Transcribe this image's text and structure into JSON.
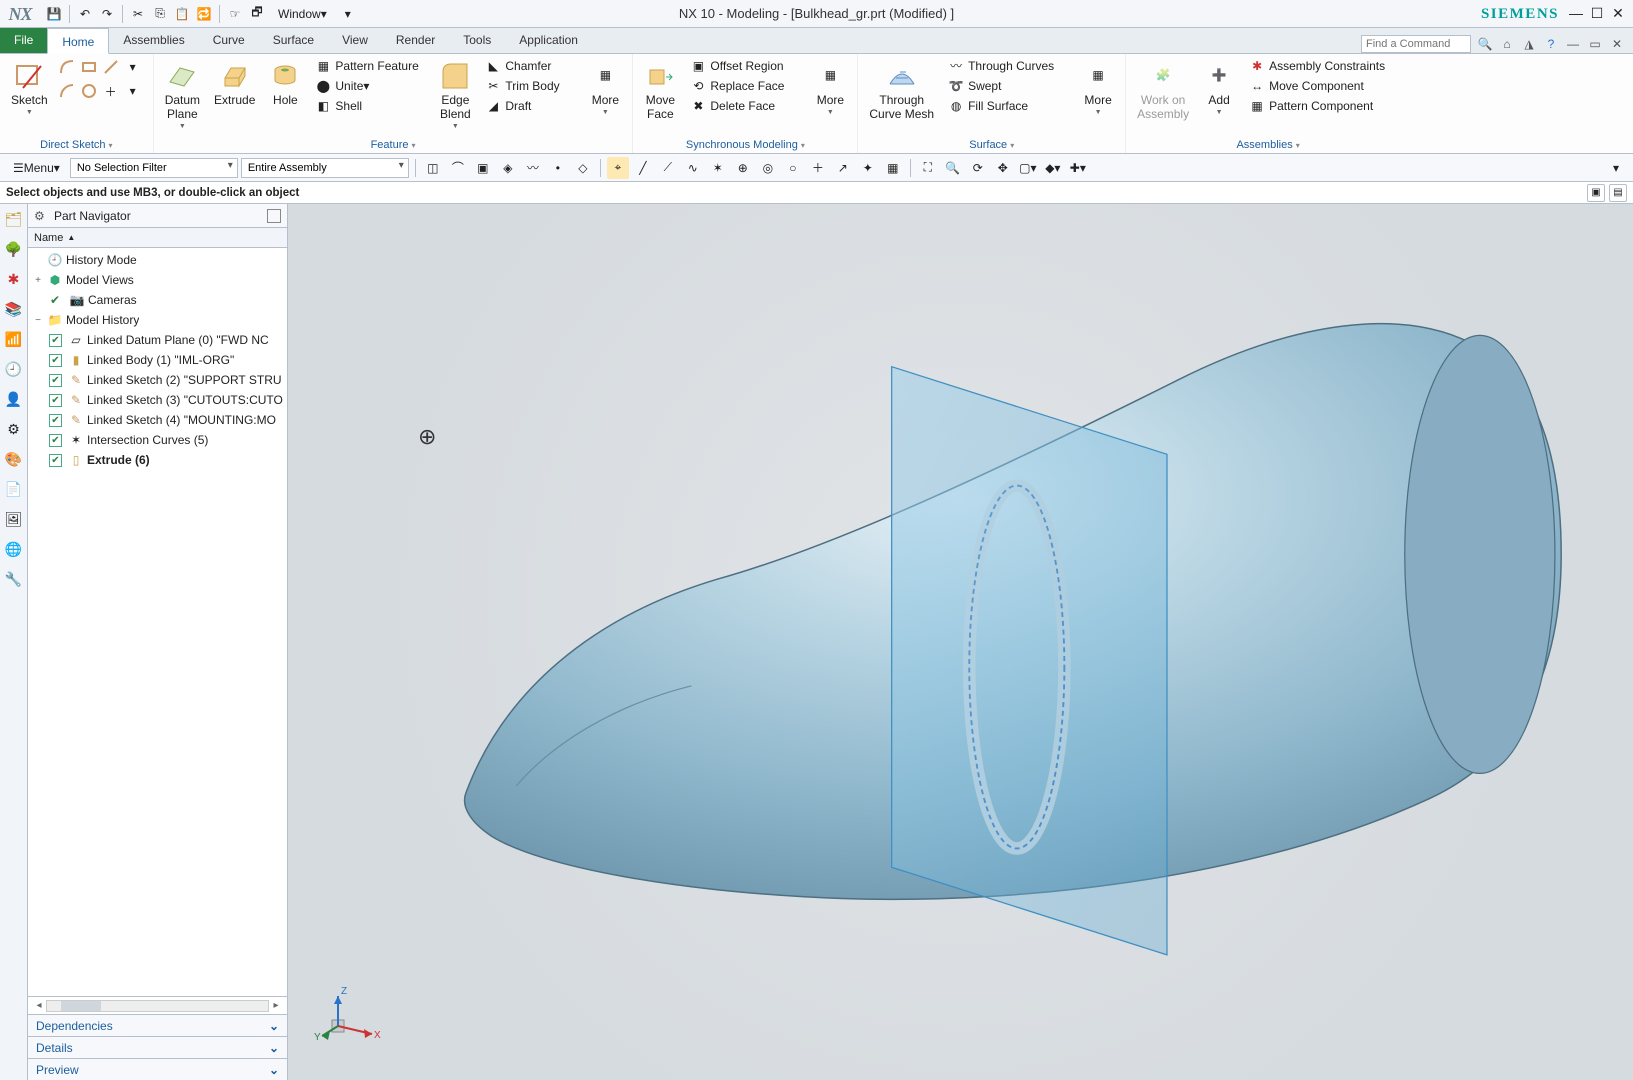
{
  "app": {
    "title": "NX 10 - Modeling - [Bulkhead_gr.prt (Modified) ]",
    "brand": "SIEMENS",
    "logo": "NX"
  },
  "qat": {
    "window_menu": "Window",
    "cmd_search_placeholder": "Find a Command"
  },
  "tabs": {
    "file": "File",
    "items": [
      "Home",
      "Assemblies",
      "Curve",
      "Surface",
      "View",
      "Render",
      "Tools",
      "Application"
    ],
    "active": "Home"
  },
  "ribbon": {
    "direct_sketch": {
      "label": "Direct Sketch",
      "sketch": "Sketch"
    },
    "feature": {
      "label": "Feature",
      "datum_plane": "Datum\nPlane",
      "extrude": "Extrude",
      "hole": "Hole",
      "pattern": "Pattern Feature",
      "unite": "Unite",
      "shell": "Shell",
      "edge_blend": "Edge\nBlend",
      "chamfer": "Chamfer",
      "trim_body": "Trim Body",
      "draft": "Draft",
      "more": "More"
    },
    "sync": {
      "label": "Synchronous Modeling",
      "move_face": "Move\nFace",
      "offset_region": "Offset Region",
      "replace_face": "Replace Face",
      "delete_face": "Delete Face",
      "more": "More"
    },
    "surface": {
      "label": "Surface",
      "through_curve_mesh": "Through\nCurve Mesh",
      "through_curves": "Through Curves",
      "swept": "Swept",
      "fill_surface": "Fill Surface",
      "more": "More"
    },
    "assemblies": {
      "label": "Assemblies",
      "work_on_assembly": "Work on\nAssembly",
      "add": "Add",
      "assembly_constraints": "Assembly Constraints",
      "move_component": "Move Component",
      "pattern_component": "Pattern Component"
    }
  },
  "toolstrip": {
    "menu_label": "Menu",
    "selection_filter": "No Selection Filter",
    "scope": "Entire Assembly"
  },
  "prompt": "Select objects and use MB3, or double-click an object",
  "navigator": {
    "title": "Part Navigator",
    "header": "Name",
    "history_mode": "History Mode",
    "model_views": "Model Views",
    "cameras": "Cameras",
    "model_history": "Model History",
    "items": [
      "Linked Datum Plane (0) \"FWD NC",
      "Linked Body (1) \"IML-ORG\"",
      "Linked Sketch (2) \"SUPPORT STRU",
      "Linked Sketch (3) \"CUTOUTS:CUTO",
      "Linked Sketch (4) \"MOUNTING:MO",
      "Intersection Curves (5)",
      "Extrude (6)"
    ],
    "dependencies": "Dependencies",
    "details": "Details",
    "preview": "Preview"
  },
  "colors": {
    "accent": "#2f73c2",
    "siemens": "#00a09a",
    "body_metal": "#9fc3d4",
    "datum_plane": "#6fb5da"
  }
}
